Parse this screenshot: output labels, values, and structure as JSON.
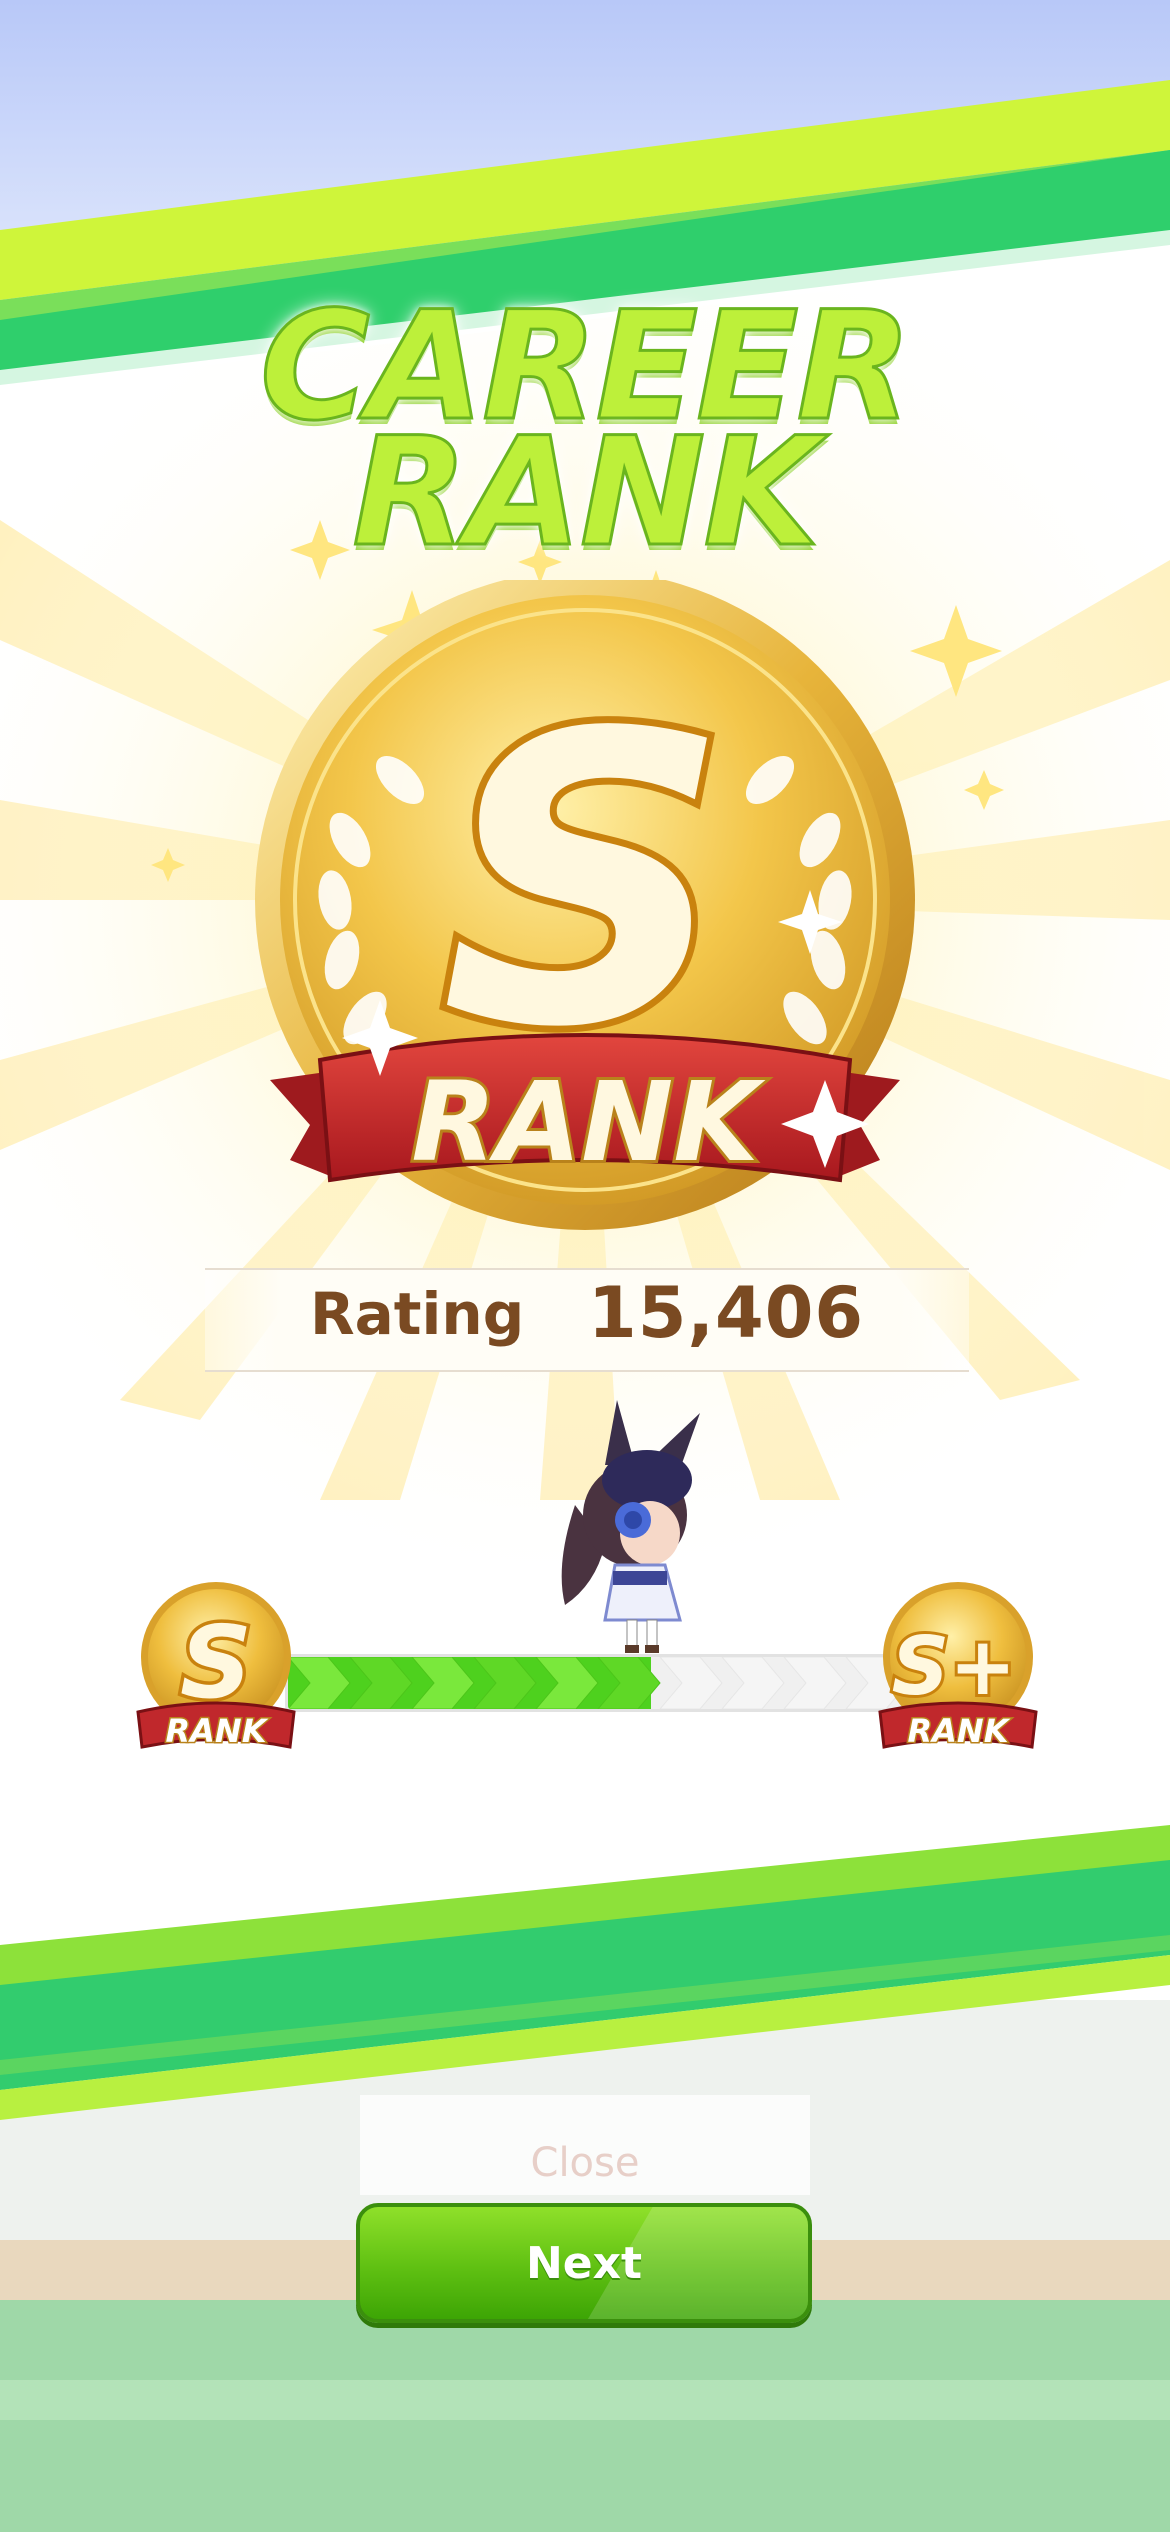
{
  "title": {
    "line1": "CAREER",
    "line2": "RANK"
  },
  "rank_badge": {
    "letter": "S",
    "ribbon_text": "RANK"
  },
  "rating": {
    "label": "Rating",
    "value": "15,406"
  },
  "progress": {
    "current_rank": {
      "letter": "S",
      "label": "RANK"
    },
    "next_rank": {
      "letter": "S+",
      "label": "RANK"
    },
    "fraction": 0.59
  },
  "faded_label": "Close",
  "next_button": {
    "label": "Next"
  },
  "colors": {
    "accent_green": "#5fc012",
    "gold": "#f0c040",
    "ribbon_red": "#c0282c",
    "text_brown": "#7a4a22"
  }
}
